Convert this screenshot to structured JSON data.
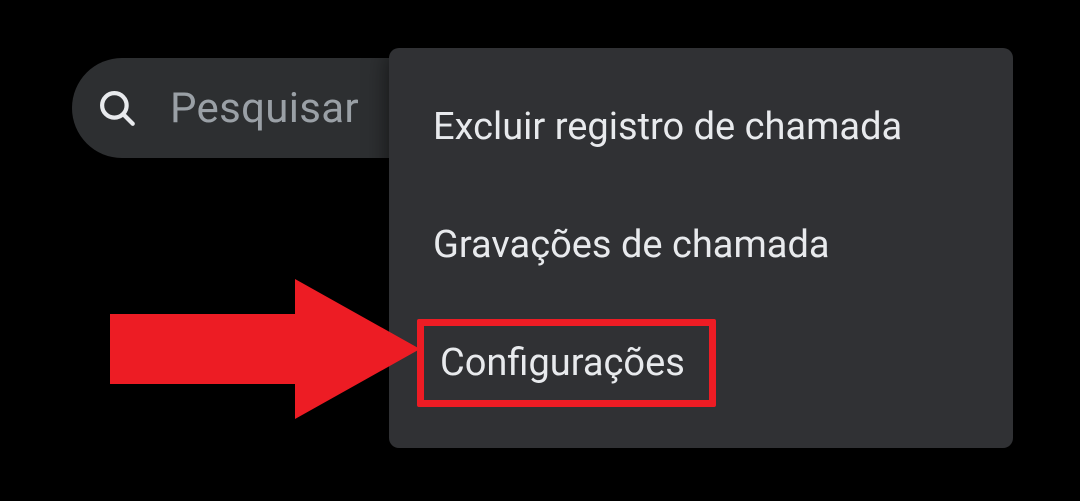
{
  "search": {
    "placeholder": "Pesquisar"
  },
  "menu": {
    "items": [
      {
        "label": "Excluir registro de chamada"
      },
      {
        "label": "Gravações de chamada"
      },
      {
        "label": "Configurações"
      }
    ]
  },
  "annotation": {
    "arrow_color": "#ed1c24",
    "highlight_color": "#ed1c24",
    "highlighted_index": 2
  }
}
